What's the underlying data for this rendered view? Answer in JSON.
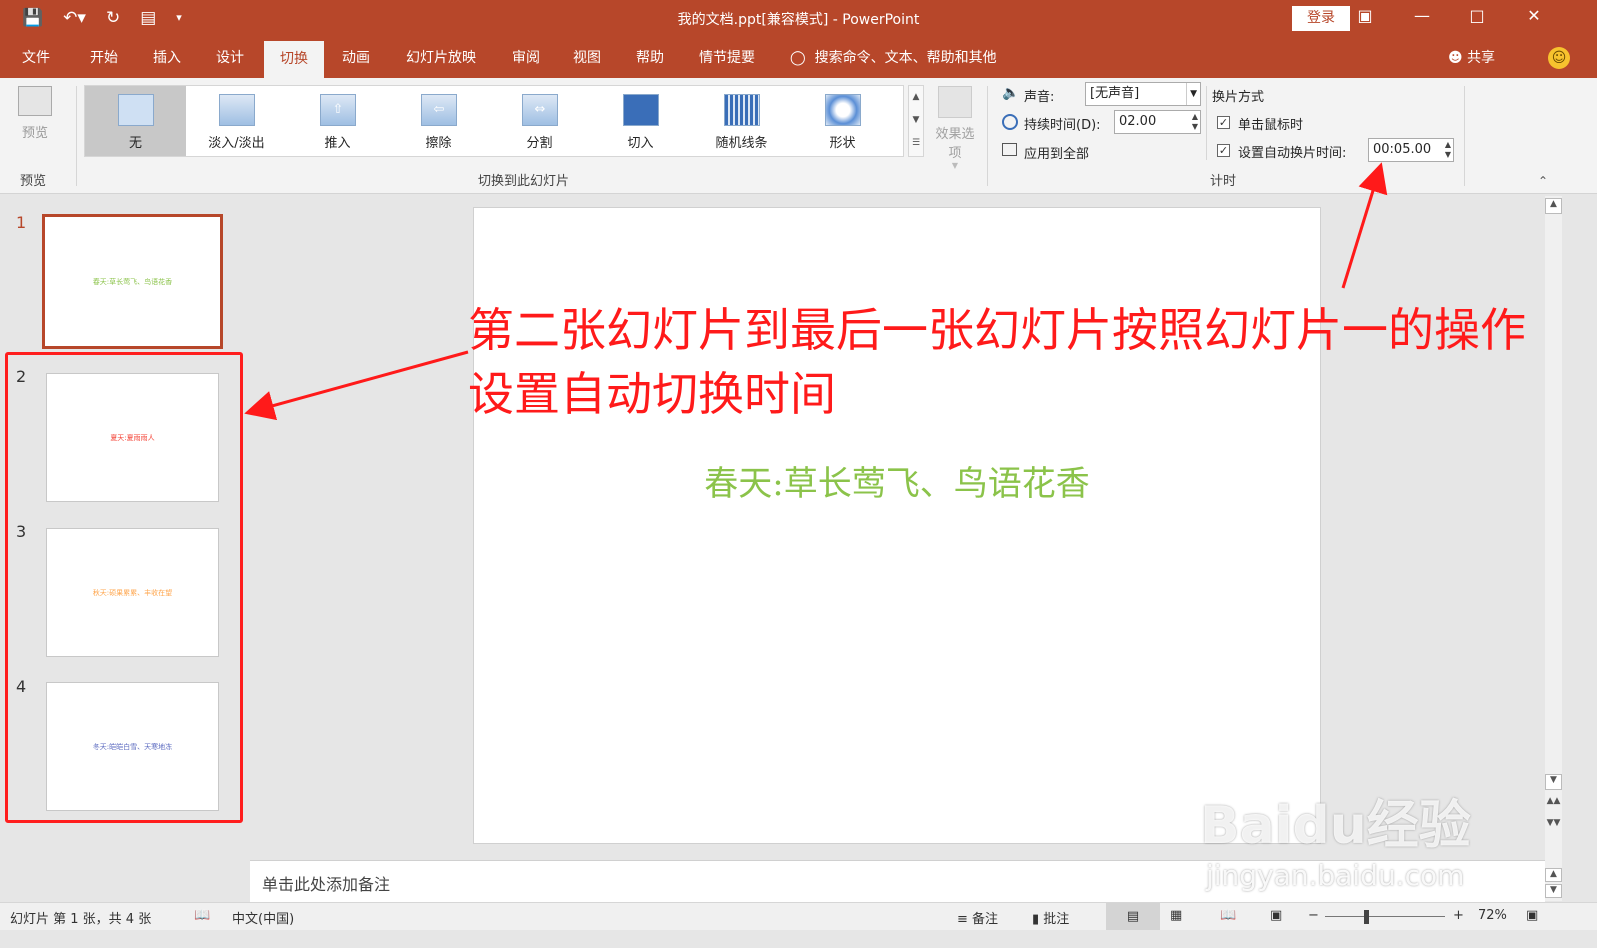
{
  "titlebar": {
    "title": "我的文档.ppt[兼容模式]  -  PowerPoint",
    "login": "登录",
    "icons": [
      "save-icon",
      "undo-icon",
      "redo-icon",
      "slideshow-icon",
      "customize-qat-icon"
    ],
    "window_controls": [
      "ribbon-display-icon",
      "minimize-icon",
      "maximize-icon",
      "close-icon"
    ]
  },
  "tabs": [
    "文件",
    "开始",
    "插入",
    "设计",
    "切换",
    "动画",
    "幻灯片放映",
    "审阅",
    "视图",
    "帮助",
    "情节提要"
  ],
  "active_tab": "切换",
  "tell_me": "搜索命令、文本、帮助和其他",
  "share": "共享",
  "ribbon": {
    "preview": {
      "label": "预览",
      "group": "预览"
    },
    "transitions": {
      "group": "切换到此幻灯片",
      "items": [
        "无",
        "淡入/淡出",
        "推入",
        "擦除",
        "分割",
        "切入",
        "随机线条",
        "形状"
      ],
      "selected": "无",
      "effect_options": "效果选项"
    },
    "timing": {
      "group": "计时",
      "sound_label": "声音:",
      "sound_value": "[无声音]",
      "duration_label": "持续时间(D):",
      "duration_value": "02.00",
      "apply_all": "应用到全部",
      "advance_heading": "换片方式",
      "on_click": "单击鼠标时",
      "on_click_checked": true,
      "after_label": "设置自动换片时间:",
      "after_value": "00:05.00",
      "after_checked": true
    }
  },
  "slides": [
    {
      "num": "1",
      "text": "春天:草长莺飞、鸟语花香",
      "color": "#8bc34a"
    },
    {
      "num": "2",
      "text": "夏天:夏雨雨人",
      "color": "#f44336"
    },
    {
      "num": "3",
      "text": "秋天:硕果累累、丰收在望",
      "color": "#ffa64d"
    },
    {
      "num": "4",
      "text": "冬天:皑皑白雪、天寒地冻",
      "color": "#5c6bc0"
    }
  ],
  "main_slide_text": "春天:草长莺飞、鸟语花香",
  "notes_placeholder": "单击此处添加备注",
  "annotation": "第二张幻灯片到最后一张幻灯片按照幻灯片一的操作设置自动切换时间",
  "status": {
    "slide_info": "幻灯片 第 1 张，共 4 张",
    "language": "中文(中国)",
    "notes": "备注",
    "comments": "批注",
    "zoom_minus": "−",
    "zoom_plus": "+",
    "zoom": "72%"
  },
  "watermark": {
    "logo": "Baidu经验",
    "url": "jingyan.baidu.com"
  },
  "colors": {
    "accent": "#b7472a",
    "annotation": "#ff1a1a"
  }
}
